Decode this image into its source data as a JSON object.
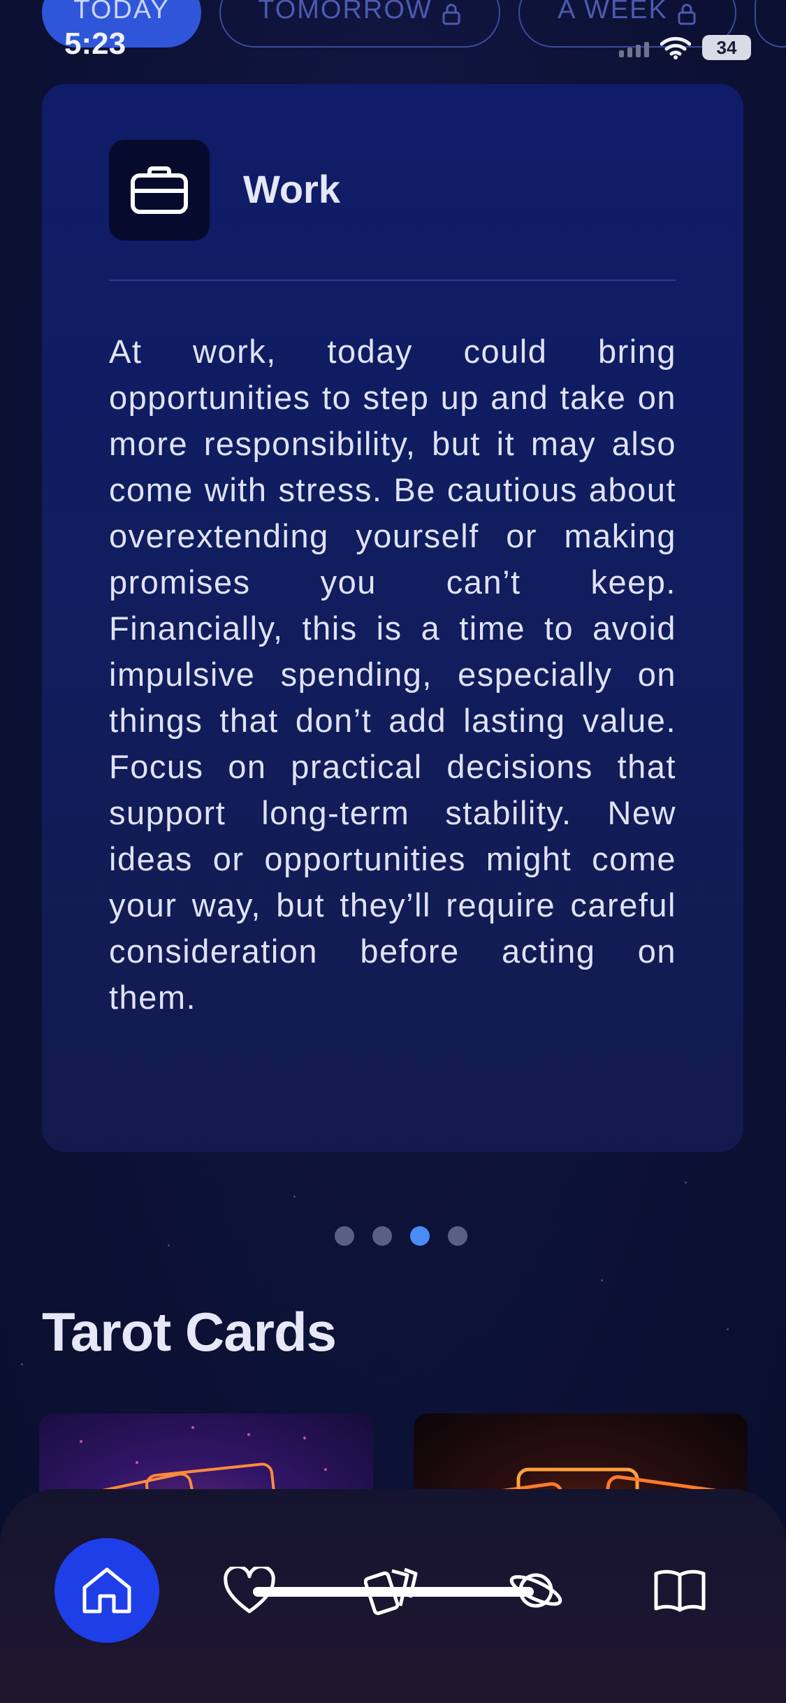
{
  "status_bar": {
    "time": "5:23",
    "battery": "34"
  },
  "period_tabs": [
    {
      "label": "TODAY",
      "active": true,
      "locked": false
    },
    {
      "label": "TOMORROW",
      "active": false,
      "locked": true
    },
    {
      "label": "A WEEK",
      "active": false,
      "locked": true
    }
  ],
  "card": {
    "icon": "briefcase-icon",
    "title": "Work",
    "body": "At work, today could bring opportunities to step up and take on more responsibility, but it may also come with stress. Be cautious about overextending yourself or making promises you can’t keep. Financially, this is a time to avoid impulsive spending, especially on things that don’t add lasting value. Focus on practical decisions that support long-term stability. New ideas or opportunities might come your way, but they’ll require careful consideration before acting on them."
  },
  "pagination": {
    "count": 4,
    "active_index": 2
  },
  "tarot_section": {
    "title": "Tarot Cards"
  },
  "bottom_nav": [
    {
      "icon": "home-icon",
      "active": true
    },
    {
      "icon": "heart-icon",
      "active": false
    },
    {
      "icon": "cards-icon",
      "active": false
    },
    {
      "icon": "planet-icon",
      "active": false
    },
    {
      "icon": "book-icon",
      "active": false
    }
  ],
  "colors": {
    "accent": "#2f56d9",
    "nav_active": "#1e3ee8",
    "dot_active": "#4a8cf5"
  }
}
